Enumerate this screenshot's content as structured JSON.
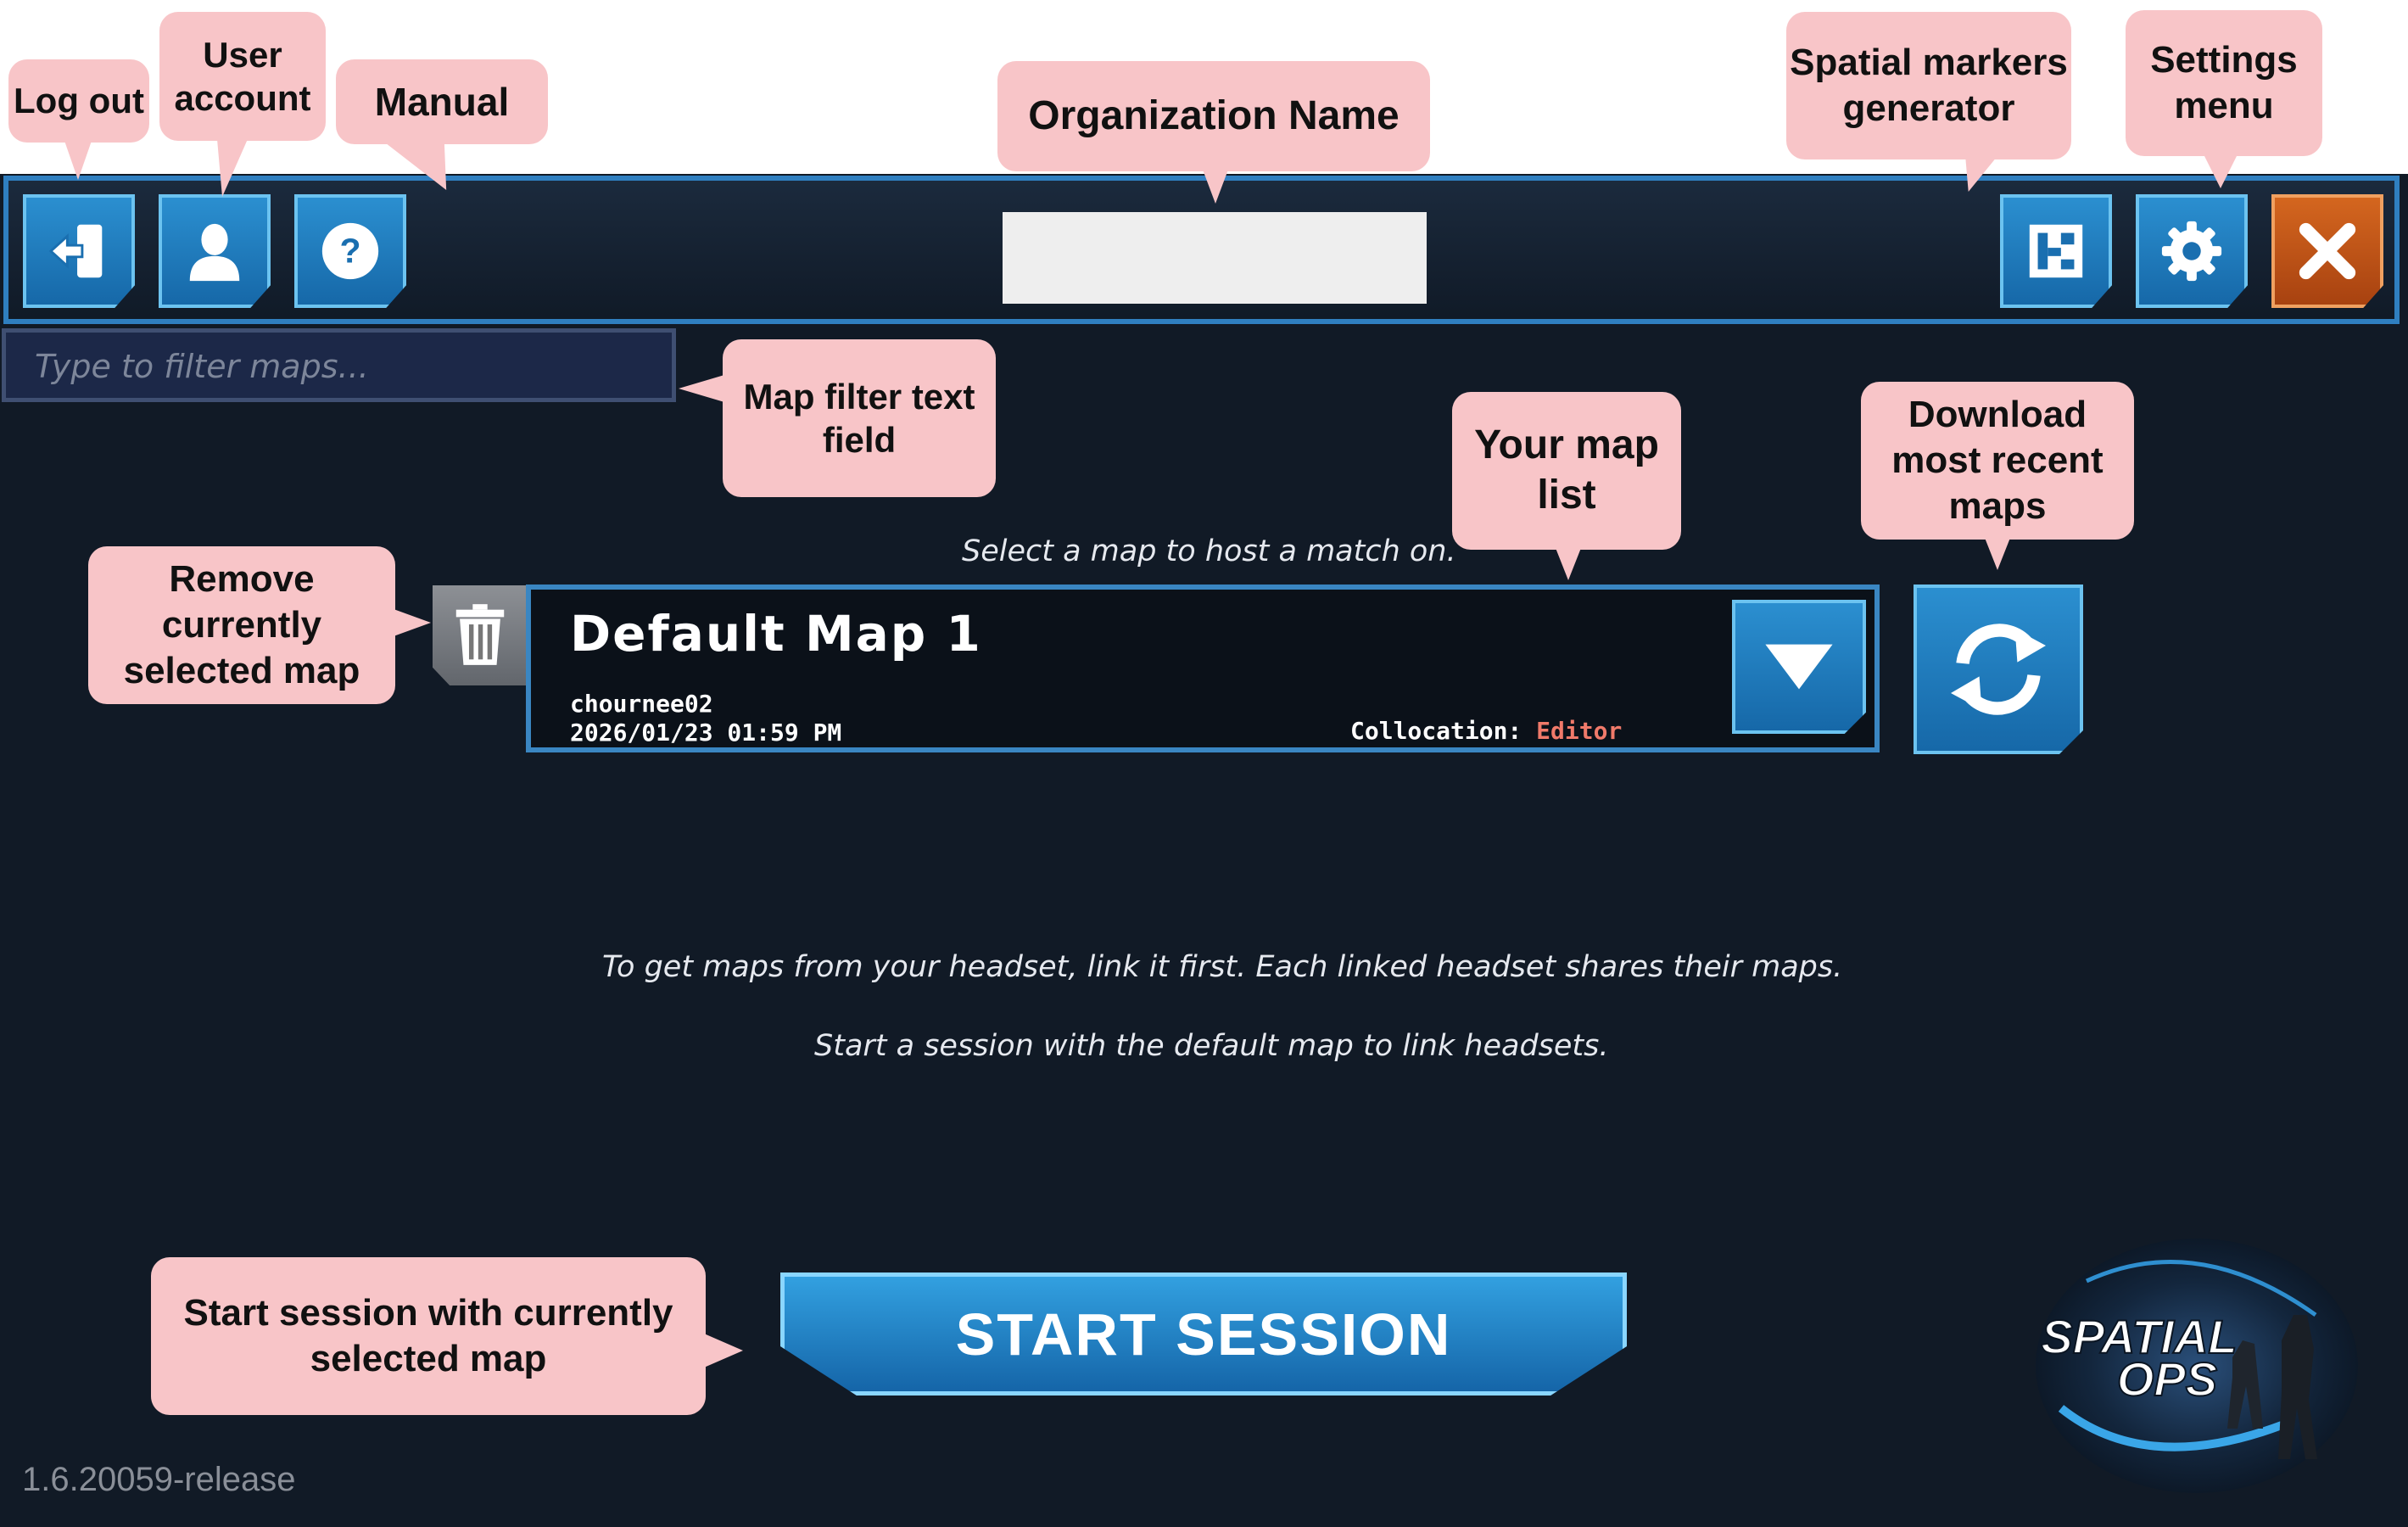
{
  "toolbar": {
    "logout_icon": "logout-arrow-icon",
    "user_icon": "user-icon",
    "manual_icon": "question-icon",
    "markers_icon": "spatial-marker-icon",
    "settings_icon": "gear-icon",
    "close_icon": "close-x-icon"
  },
  "filter": {
    "placeholder": "Type to filter maps..."
  },
  "prompt": "Select a map to host a match on.",
  "map": {
    "title": "Default Map 1",
    "owner": "chournee02",
    "date": "2026/01/23 01:59 PM",
    "collocation_label": "Collocation:",
    "collocation_value": "Editor"
  },
  "info": {
    "line1": "To get maps from your headset, link it first. Each linked headset shares their maps.",
    "line2": "Start a session with the default map to link headsets."
  },
  "start_button": "START SESSION",
  "version": "1.6.20059-release",
  "logo": {
    "line1": "SPATIAL",
    "line2": "OPS"
  },
  "callouts": {
    "logout": "Log out",
    "user_account_1": "User",
    "user_account_2": "account",
    "manual": "Manual",
    "org_name": "Organization Name",
    "markers_1": "Spatial markers",
    "markers_2": "generator",
    "settings_1": "Settings",
    "settings_2": "menu",
    "filter_1": "Map filter text",
    "filter_2": "field",
    "map_list_1": "Your map",
    "map_list_2": "list",
    "download_1": "Download",
    "download_2": "most recent",
    "download_3": "maps",
    "remove_1": "Remove",
    "remove_2": "currently",
    "remove_3": "selected map",
    "start_1": "Start session with currently",
    "start_2": "selected map"
  },
  "colors": {
    "background": "#111a26",
    "accent_blue": "#2b8fd0",
    "close_orange": "#d4661f",
    "callout_pink": "#f8c5c8",
    "collocation_value": "#f07a6a"
  }
}
